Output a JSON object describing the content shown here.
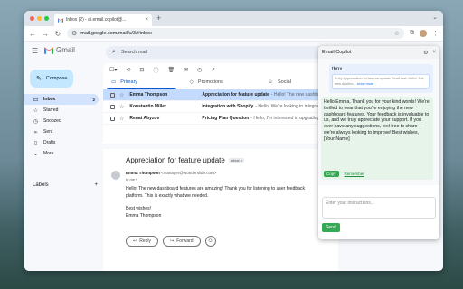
{
  "browser": {
    "tab_title": "Inbox (2) - ai.email.copilot@...",
    "new_tab_symbol": "+",
    "url": "mail.google.com/mail/u/3/#inbox"
  },
  "gmail": {
    "logo_text": "Gmail",
    "search_placeholder": "Search mail",
    "compose_label": "Compose",
    "nav": [
      {
        "label": "Inbox",
        "count": "2",
        "icon": "inbox-icon"
      },
      {
        "label": "Starred",
        "count": "",
        "icon": "star-icon"
      },
      {
        "label": "Snoozed",
        "count": "",
        "icon": "clock-icon"
      },
      {
        "label": "Sent",
        "count": "",
        "icon": "send-icon"
      },
      {
        "label": "Drafts",
        "count": "",
        "icon": "draft-icon"
      },
      {
        "label": "More",
        "count": "",
        "icon": "chevron-down-icon"
      }
    ],
    "labels_header": "Labels",
    "labels_add": "+",
    "tabs": [
      {
        "label": "Primary",
        "icon": "inbox-icon"
      },
      {
        "label": "Promotions",
        "icon": "tag-icon"
      },
      {
        "label": "Social",
        "icon": "people-icon"
      }
    ],
    "emails": [
      {
        "sender": "Emma Thompson",
        "subject": "Appreciation for feature update",
        "snippet": "- Hello! The new dashboard",
        "selected": true
      },
      {
        "sender": "Konstantin Miller",
        "subject": "Integration with Shopify",
        "snippet": "- Hello, We're looking to integrat",
        "selected": false
      },
      {
        "sender": "Renat Abyzov",
        "subject": "Pricing Plan Question",
        "snippet": "- Hello, I'm interested in upgrading to",
        "selected": false
      }
    ],
    "reading": {
      "subject": "Appreciation for feature update",
      "badge": "Inbox ×",
      "from_name": "Emma Thompson",
      "from_addr": "<manager@wonderslide.com>",
      "to": "to me ▾",
      "body_line1": "Hello! The new dashboard features are amazing! Thank you for listening to user feedback",
      "body_line2": "platform. This is exactly what we needed.",
      "body_line3": "Best wishes!",
      "body_line4": "Emma Thompson",
      "reply_label": "Reply",
      "forward_label": "Forward"
    }
  },
  "copilot": {
    "title": "Email Copilot",
    "user_message": "thnx",
    "context_text": "Subj: Appreciation for feature update Email text: Hello! The new dashbo...",
    "context_more": "show more",
    "ai_reply": "Hello Emma, Thank you for your kind words! We're thrilled to hear that you're enjoying the new dashboard features. Your feedback is invaluable to us, and we truly appreciate your support. If you ever have any suggestions, feel free to share—we're always looking to improve! Best wishes, [Your Name]",
    "copy_label": "Copy",
    "remember_label": "Remember",
    "input_placeholder": "Enter your instructions...",
    "send_label": "Send"
  }
}
